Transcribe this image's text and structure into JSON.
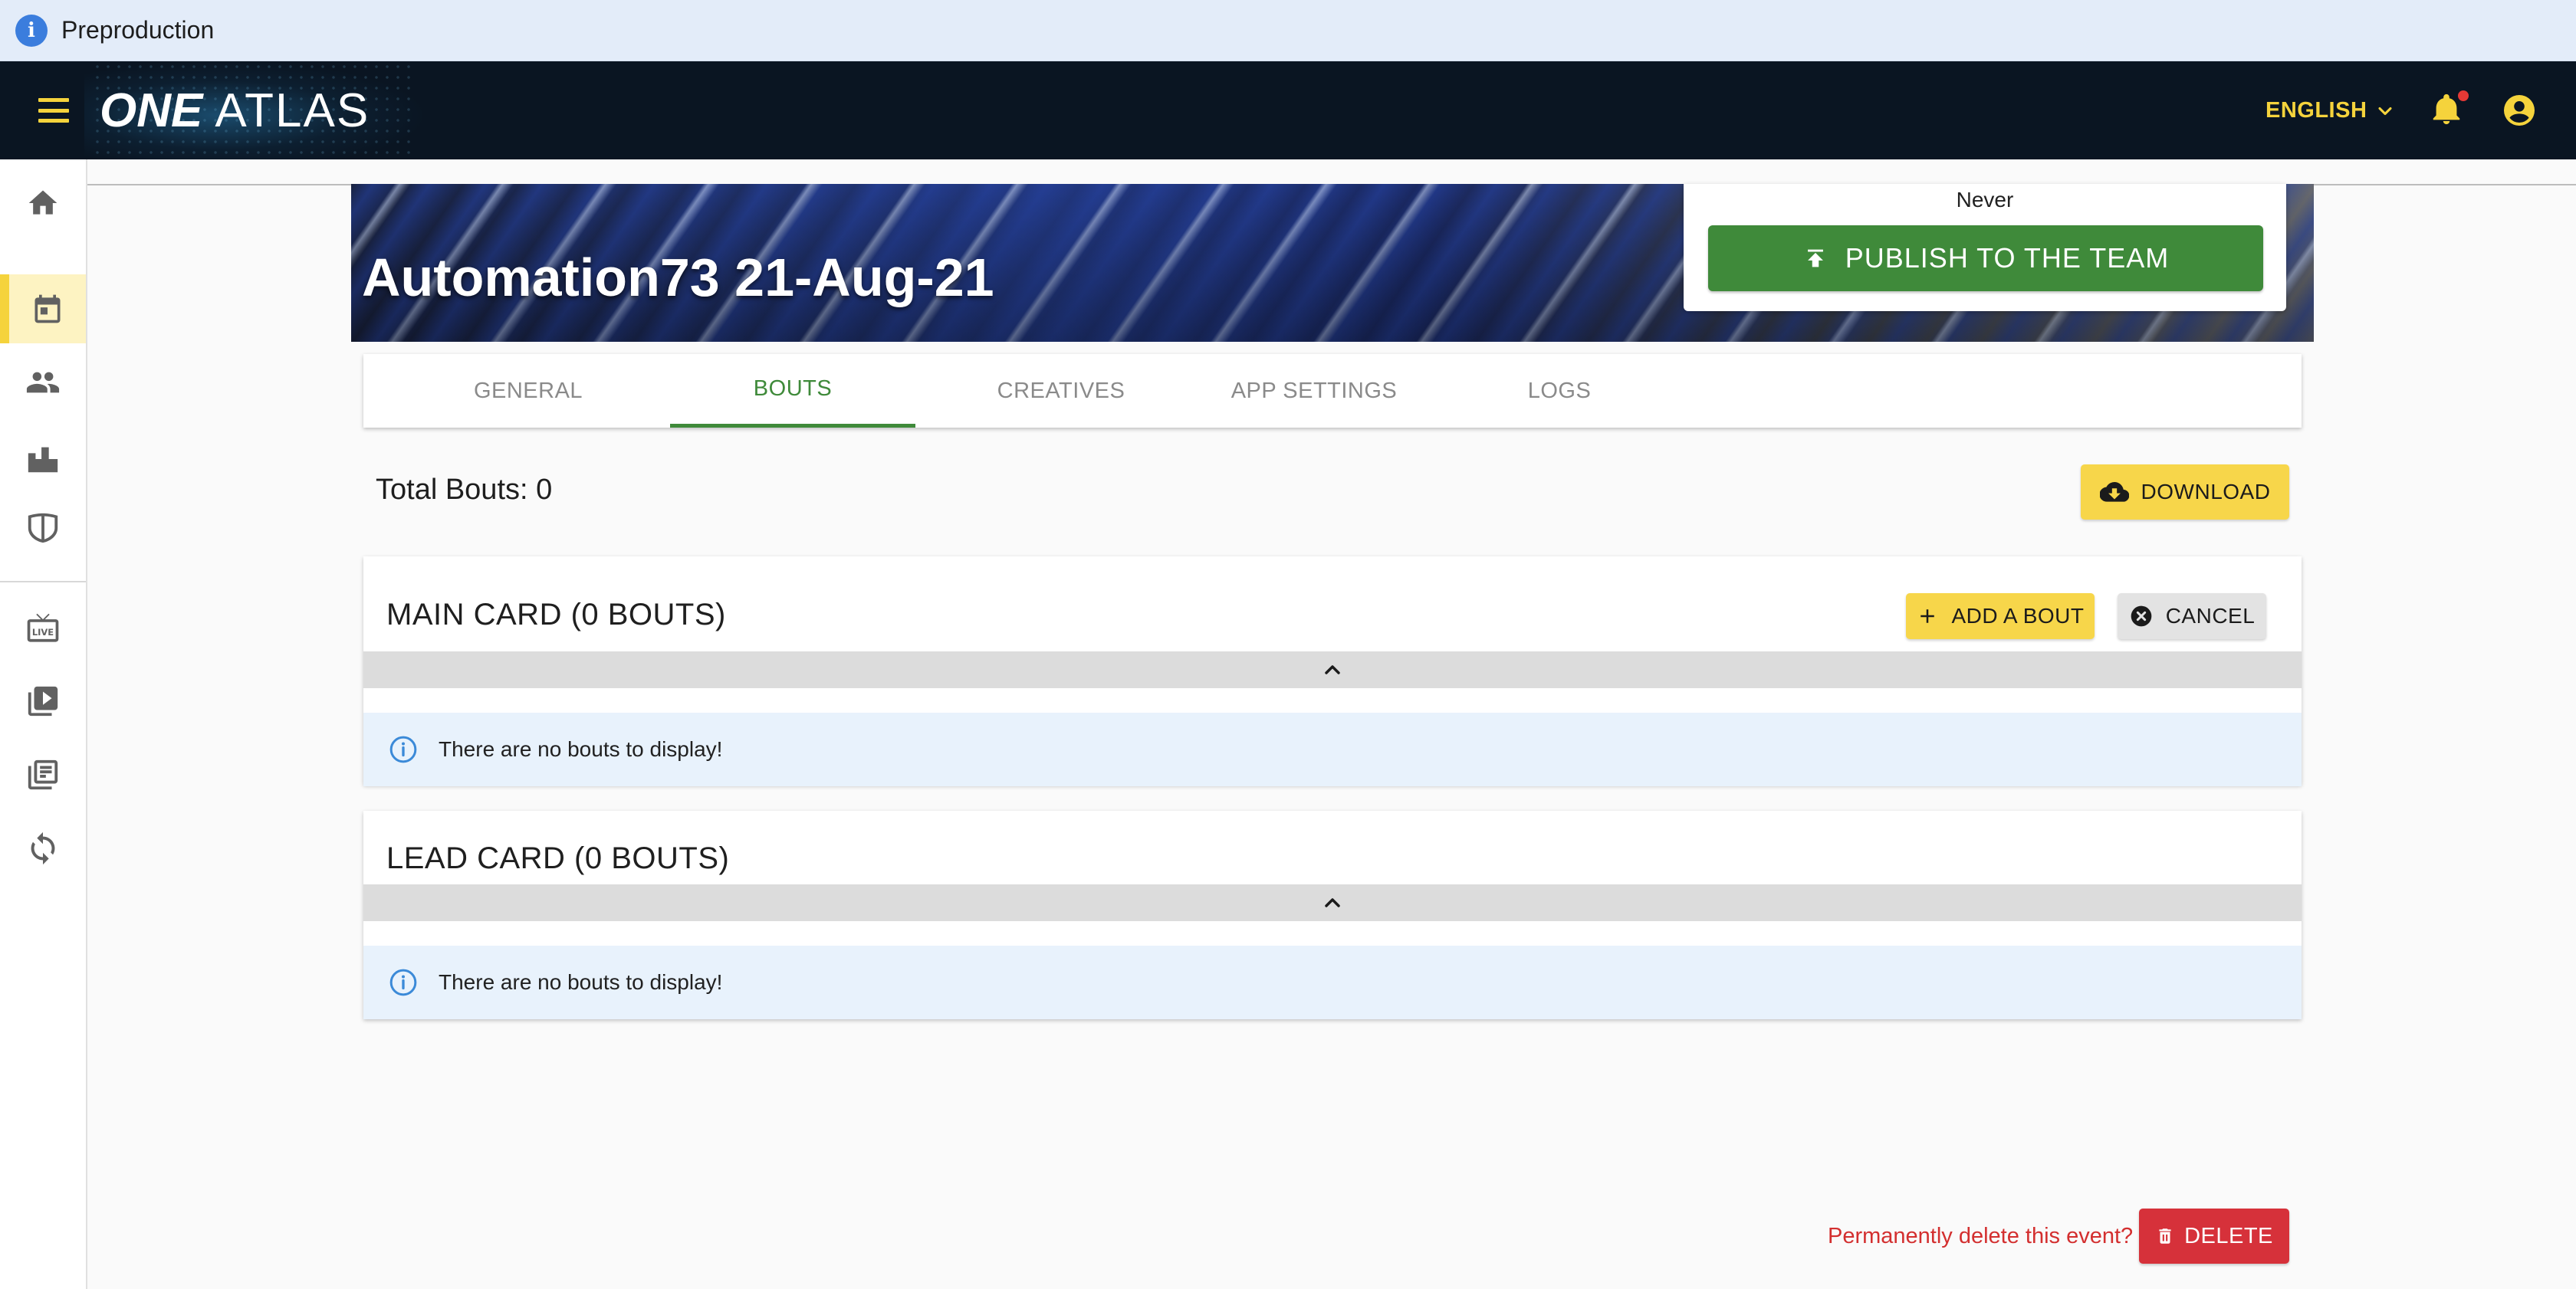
{
  "env_banner": {
    "label": "Preproduction"
  },
  "appbar": {
    "logo_one": "ONE",
    "logo_atlas": "ATLAS",
    "language": "ENGLISH",
    "accent_color": "#f5d33c"
  },
  "event": {
    "title": "Automation73 21-Aug-21",
    "last_published": "Never",
    "publish_label": "PUBLISH TO THE TEAM"
  },
  "tabs": [
    {
      "label": "GENERAL",
      "active": false
    },
    {
      "label": "BOUTS",
      "active": true
    },
    {
      "label": "CREATIVES",
      "active": false
    },
    {
      "label": "APP SETTINGS",
      "active": false
    },
    {
      "label": "LOGS",
      "active": false
    }
  ],
  "bouts": {
    "total_label": "Total Bouts: 0",
    "download_label": "DOWNLOAD"
  },
  "main_card": {
    "title": "MAIN CARD (0 BOUTS)",
    "add_label": "ADD A BOUT",
    "cancel_label": "CANCEL",
    "empty_message": "There are no bouts to display!"
  },
  "lead_card": {
    "title": "LEAD CARD (0 BOUTS)",
    "empty_message": "There are no bouts to display!"
  },
  "danger": {
    "prompt": "Permanently delete this event?",
    "delete_label": "DELETE"
  },
  "sidebar": {
    "items": [
      {
        "icon": "home-icon"
      },
      {
        "icon": "calendar-icon",
        "active": true
      },
      {
        "icon": "people-icon"
      },
      {
        "icon": "venue-icon"
      },
      {
        "icon": "shield-icon"
      },
      {
        "icon": "live-tv-icon"
      },
      {
        "icon": "video-library-icon"
      },
      {
        "icon": "collections-icon"
      },
      {
        "icon": "sync-icon"
      }
    ]
  }
}
